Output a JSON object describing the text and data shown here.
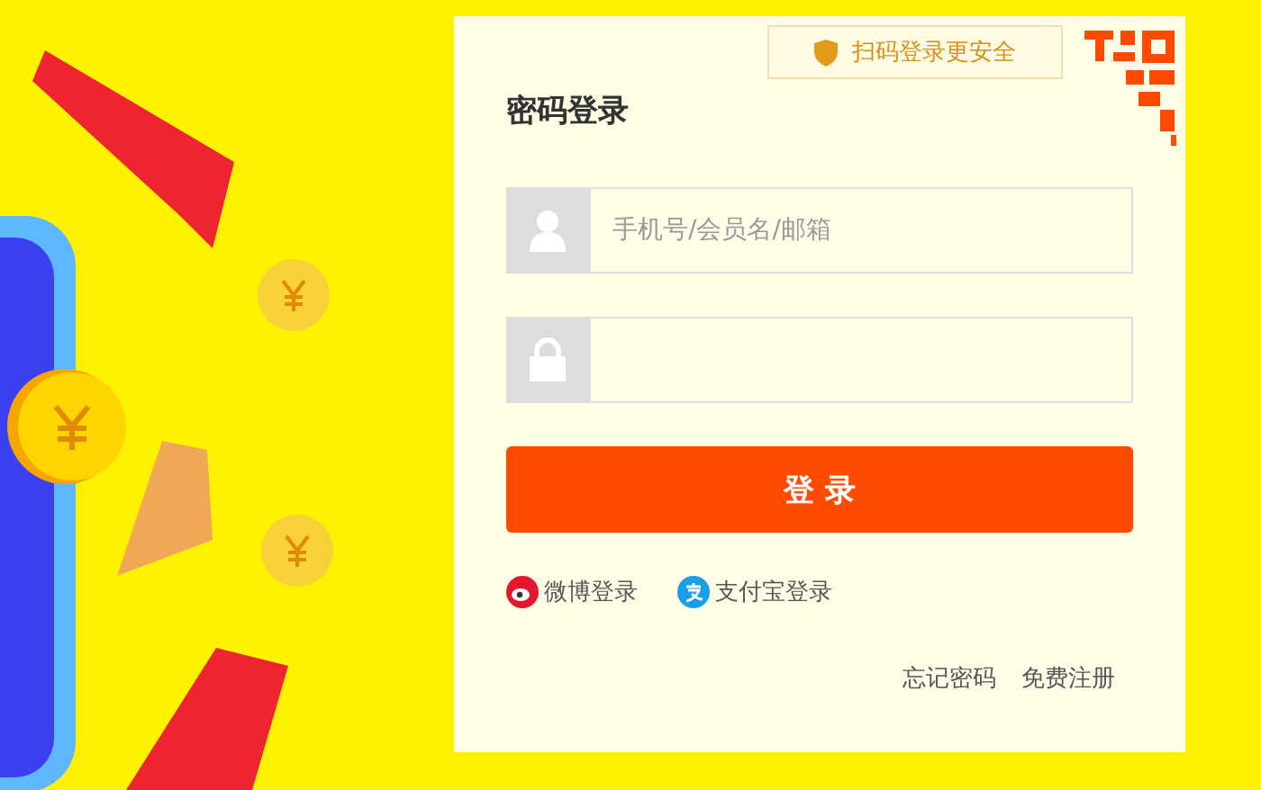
{
  "qr_tip": {
    "label": "扫码登录更安全"
  },
  "login": {
    "title": "密码登录",
    "fields": [
      {
        "kind": "user",
        "placeholder": "手机号/会员名/邮箱"
      },
      {
        "kind": "password"
      }
    ],
    "submit": "登 录",
    "social": [
      {
        "kind": "weibo",
        "label": "微博登录"
      },
      {
        "kind": "alipay",
        "label": "支付宝登录"
      }
    ],
    "links": [
      "忘记密码",
      "免费注册"
    ]
  }
}
